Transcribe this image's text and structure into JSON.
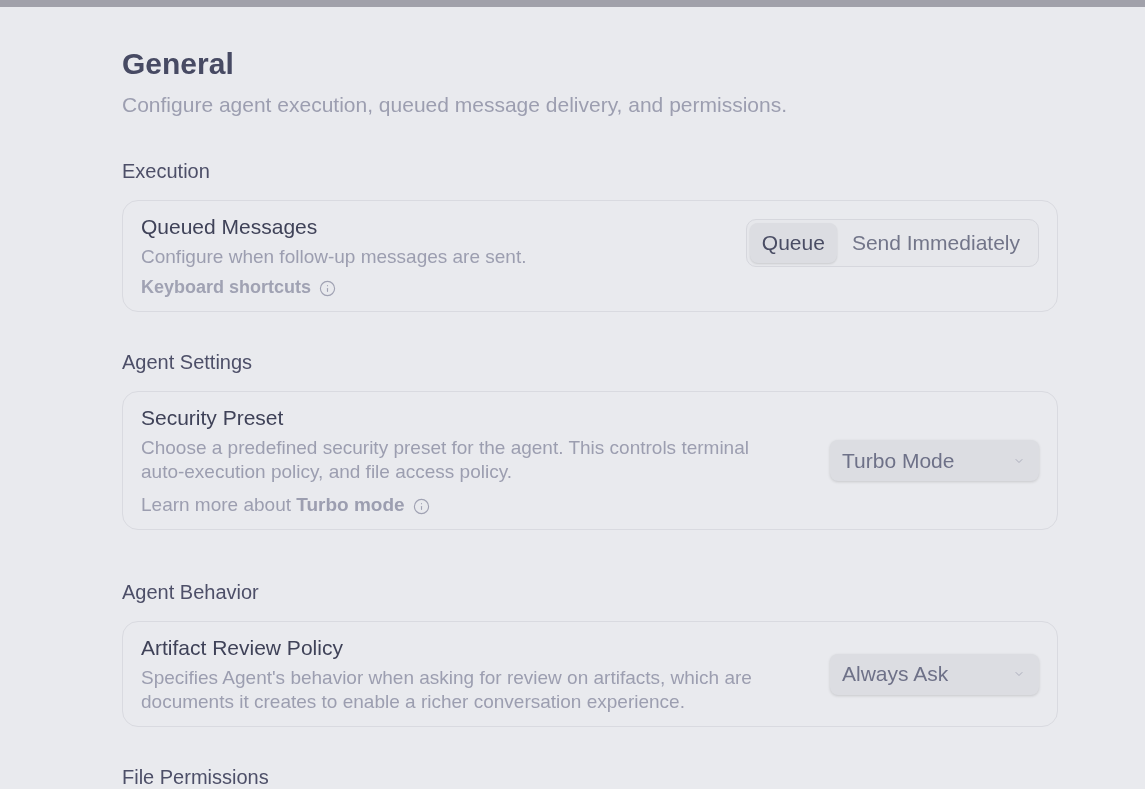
{
  "page": {
    "title": "General",
    "subtitle": "Configure agent execution, queued message delivery, and permissions."
  },
  "sections": [
    {
      "heading": "Execution",
      "settings": [
        {
          "title": "Queued Messages",
          "description": "Configure when follow-up messages are sent.",
          "note": {
            "kind": "link",
            "text": "Keyboard shortcuts"
          },
          "control": {
            "kind": "segmented",
            "options": [
              {
                "label": "Queue",
                "selected": true
              },
              {
                "label": "Send Immediately",
                "selected": false
              }
            ]
          }
        }
      ]
    },
    {
      "heading": "Agent Settings",
      "settings": [
        {
          "title": "Security Preset",
          "description": "Choose a predefined security preset for the agent. This controls terminal auto-execution policy, and file access policy.",
          "note": {
            "kind": "text",
            "text": "Learn more about **Turbo mode**"
          },
          "control": {
            "kind": "select",
            "value": "Turbo Mode"
          }
        }
      ]
    },
    {
      "heading": "Agent Behavior",
      "settings": [
        {
          "title": "Artifact Review Policy",
          "description": "Specifies Agent's behavior when asking for review on artifacts, which are documents it creates to enable a richer conversation experience.",
          "control": {
            "kind": "select",
            "value": "Always Ask"
          }
        }
      ]
    },
    {
      "heading": "File Permissions"
    }
  ]
}
